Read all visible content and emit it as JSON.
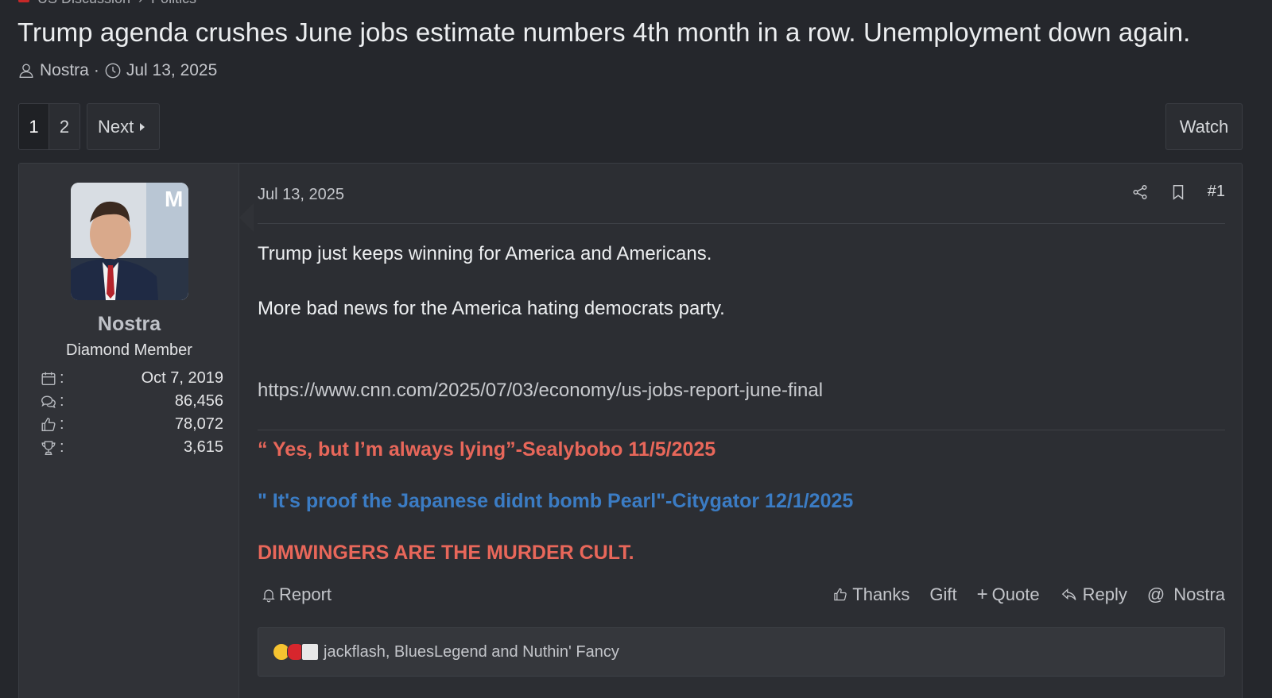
{
  "breadcrumb": {
    "forum": "US Discussion",
    "subforum": "Politics"
  },
  "thread": {
    "title": "Trump agenda crushes June jobs estimate numbers 4th month in a row. Unemployment down again.",
    "author": "Nostra",
    "separator": "·",
    "date": "Jul 13, 2025"
  },
  "pagination": {
    "pages": [
      "1",
      "2"
    ],
    "current": "1",
    "next_label": "Next"
  },
  "watch_label": "Watch",
  "post": {
    "date": "Jul 13, 2025",
    "number": "#1",
    "user": {
      "name": "Nostra",
      "title": "Diamond Member",
      "stats": [
        {
          "icon": "calendar-icon",
          "label": ":",
          "value": "Oct 7, 2019"
        },
        {
          "icon": "messages-icon",
          "label": ":",
          "value": "86,456"
        },
        {
          "icon": "thumbs-up-icon",
          "label": ":",
          "value": "78,072"
        },
        {
          "icon": "trophy-icon",
          "label": ":",
          "value": "3,615"
        }
      ]
    },
    "body": {
      "line1": "Trump just keeps winning for America and Americans.",
      "line2": "More bad news for the America hating democrats party.",
      "link": "https://www.cnn.com/2025/07/03/economy/us-jobs-report-june-final"
    },
    "signature": {
      "line1": "“ Yes, but I’m always lying”-Sealybobo 11/5/2025",
      "line2": "\" It's proof the Japanese didnt bomb Pearl\"-Citygator 12/1/2025",
      "line3": "DIMWINGERS ARE THE MURDER CULT."
    },
    "actions": {
      "report": "Report",
      "thanks": "Thanks",
      "gift": "Gift",
      "quote": "Quote",
      "reply": "Reply",
      "mention": "Nostra"
    },
    "reactions": {
      "text": "jackflash, BluesLegend and Nuthin' Fancy"
    }
  },
  "colors": {
    "background": "#25272c",
    "sig_red": "#e8675a",
    "sig_blue": "#3b7cc4"
  }
}
